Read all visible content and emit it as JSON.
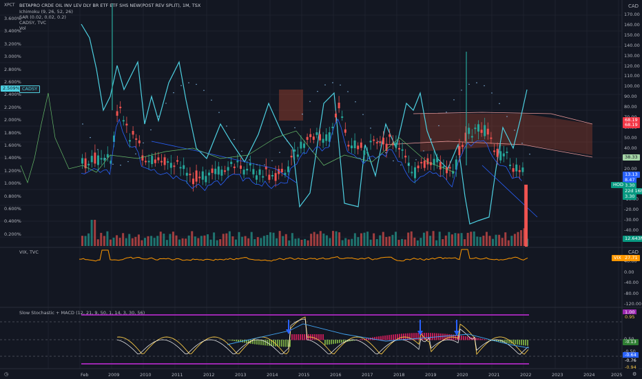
{
  "header": {
    "logo": "ⅩPCT",
    "title": "BETAPRO CRDE OIL INV LEV DLY BR ETF ETF SHS NEW(POST REV SPLIT), 1M, TSX",
    "indicators": [
      "Ichimoku (9, 26, 52, 26)",
      "SAR (0.02, 0.02, 0.2)",
      "CADSY, TVC",
      "Vol"
    ],
    "currency": "CAD"
  },
  "left_axis": {
    "ticks": [
      "3.600%",
      "3.400%",
      "3.200%",
      "3.000%",
      "2.800%",
      "2.600%",
      "2.400%",
      "2.200%",
      "2.000%",
      "1.800%",
      "1.600%",
      "1.400%",
      "1.200%",
      "1.000%",
      "0.800%",
      "0.600%",
      "0.400%",
      "0.200%"
    ],
    "badge_value": "2.509%",
    "badge_label": "CADSY"
  },
  "right_axis": {
    "ticks": [
      "170.00",
      "160.00",
      "150.00",
      "140.00",
      "130.00",
      "120.00",
      "110.00",
      "100.00",
      "90.00",
      "80.00",
      "70.00",
      "60.00",
      "50.00",
      "40.00",
      "30.00",
      "20.00",
      "10.00",
      "0.00",
      "-10.00",
      "-20.00",
      "-30.00",
      "-40.00"
    ],
    "badges": [
      {
        "value": "68.19",
        "color": "#f23645"
      },
      {
        "value": "68.19",
        "color": "#f23645"
      },
      {
        "value": "38.33",
        "color": "#a5d6a7",
        "text_color": "#131722"
      },
      {
        "value": "13.13",
        "color": "#2962ff"
      },
      {
        "value": "8.47",
        "color": "#2962ff"
      },
      {
        "value": "3.30",
        "color": "#089981"
      },
      {
        "value": "22d 16h",
        "color": "#089981"
      },
      {
        "value": "3.30",
        "color": "#089981"
      },
      {
        "value": "12.643M",
        "color": "#089981"
      }
    ],
    "hod_label": "HOD"
  },
  "vix_pane": {
    "label": "VIX, TVC",
    "currency": "CAD",
    "ticks": [
      "40.00",
      "0.00",
      "-40.00",
      "-80.00",
      "-120.00"
    ],
    "badge_label": "VIX",
    "badge_value": "27.71"
  },
  "stoch_pane": {
    "label": "Slow Stochastic + MACD (12, 21, 9, 50, 1, 14, 3, 30, 56)",
    "ticks": [
      "1.00",
      "0.95",
      "0.50",
      "-0.13",
      "-0.50",
      "-0.64",
      "-0.76",
      "-0.94"
    ],
    "badges": [
      {
        "value": "1.00",
        "color": "#9c27b0"
      },
      {
        "value": "0.95",
        "color": "#131722",
        "text_color": "#f7c948"
      },
      {
        "value": "-0.13",
        "color": "#2e7d32"
      },
      {
        "value": "-0.64",
        "color": "#2962ff"
      },
      {
        "value": "-0.76",
        "color": "#131722",
        "text_color": "#ffffff"
      },
      {
        "value": "-0.94",
        "color": "#131722",
        "text_color": "#f7c948"
      }
    ]
  },
  "x_axis": {
    "labels": [
      "Feb",
      "2009",
      "2010",
      "2011",
      "2012",
      "2013",
      "2014",
      "2015",
      "2016",
      "2017",
      "2018",
      "2019",
      "2020",
      "2021",
      "2022",
      "2023",
      "2024",
      "2025"
    ]
  },
  "colors": {
    "background": "#131722",
    "up": "#26a69a",
    "down": "#ef5350",
    "cadsy": "#4dd0e1",
    "vix": "#ff9800",
    "kumo": "#a5432f"
  }
}
